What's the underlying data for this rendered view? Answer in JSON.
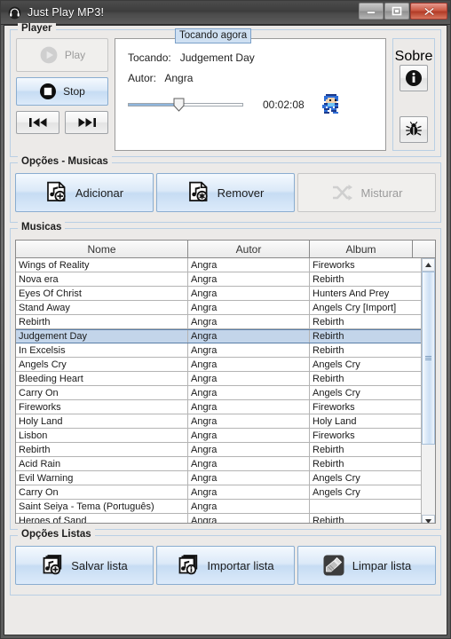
{
  "window": {
    "title": "Just Play MP3!",
    "icon": "headphones-icon",
    "controls": {
      "minimize": "minimize-icon",
      "maximize": "maximize-icon",
      "close": "close-icon"
    }
  },
  "player": {
    "legend": "Player",
    "play_label": "Play",
    "stop_label": "Stop",
    "prev_label": "previous-track-icon",
    "next_label": "next-track-icon",
    "now_playing_badge": "Tocando agora",
    "track_label": "Tocando:",
    "track_value": "Judgement Day",
    "artist_label": "Autor:",
    "artist_value": "Angra",
    "time": "00:02:08",
    "progress_percent": 44,
    "sprite": "megaman-sprite"
  },
  "sobre": {
    "legend": "Sobre",
    "info_button": "info-icon",
    "bug_button": "bug-icon"
  },
  "song_options": {
    "legend": "Opções - Musicas",
    "buttons": [
      {
        "label": "Adicionar",
        "icon": "add-music-icon",
        "enabled": true
      },
      {
        "label": "Remover",
        "icon": "remove-music-icon",
        "enabled": true
      },
      {
        "label": "Misturar",
        "icon": "shuffle-icon",
        "enabled": false
      }
    ]
  },
  "musicas": {
    "legend": "Musicas",
    "columns": [
      "Nome",
      "Autor",
      "Album"
    ],
    "selected_index": 5,
    "rows": [
      {
        "nome": "Wings of Reality",
        "autor": "Angra",
        "album": "Fireworks"
      },
      {
        "nome": "Nova era",
        "autor": "Angra",
        "album": "Rebirth"
      },
      {
        "nome": "Eyes Of Christ",
        "autor": "Angra",
        "album": "Hunters And Prey"
      },
      {
        "nome": "Stand Away",
        "autor": "Angra",
        "album": "Angels Cry [Import]"
      },
      {
        "nome": "Rebirth",
        "autor": "Angra",
        "album": "Rebirth"
      },
      {
        "nome": "Judgement Day",
        "autor": "Angra",
        "album": "Rebirth"
      },
      {
        "nome": "In Excelsis",
        "autor": "Angra",
        "album": "Rebirth"
      },
      {
        "nome": "Angels Cry",
        "autor": "Angra",
        "album": "Angels Cry"
      },
      {
        "nome": "Bleeding Heart",
        "autor": "Angra",
        "album": "Rebirth"
      },
      {
        "nome": "Carry On",
        "autor": "Angra",
        "album": "Angels Cry"
      },
      {
        "nome": "Fireworks",
        "autor": "Angra",
        "album": "Fireworks"
      },
      {
        "nome": "Holy Land",
        "autor": "Angra",
        "album": "Holy Land"
      },
      {
        "nome": "Lisbon",
        "autor": "Angra",
        "album": "Fireworks"
      },
      {
        "nome": "Rebirth",
        "autor": "Angra",
        "album": "Rebirth"
      },
      {
        "nome": "Acid Rain",
        "autor": "Angra",
        "album": "Rebirth"
      },
      {
        "nome": "Evil Warning",
        "autor": "Angra",
        "album": "Angels Cry"
      },
      {
        "nome": "Carry On",
        "autor": "Angra",
        "album": "Angels Cry"
      },
      {
        "nome": " Saint Seiya - Tema (Português)",
        "autor": "Angra",
        "album": ""
      },
      {
        "nome": "Heroes of Sand",
        "autor": "Angra",
        "album": "Rebirth"
      }
    ],
    "scrollbar": {
      "up": "scroll-up-icon",
      "down": "scroll-down-icon",
      "thumb_percent": 71
    }
  },
  "list_options": {
    "legend": "Opções Listas",
    "buttons": [
      {
        "label": "Salvar lista",
        "icon": "save-list-icon"
      },
      {
        "label": "Importar lista",
        "icon": "import-list-icon"
      },
      {
        "label": "Limpar lista",
        "icon": "clear-list-icon"
      }
    ]
  },
  "colors": {
    "accent": "#b9cfe4",
    "selection": "#c3d5ea",
    "badge_bg": "#cfe0f2",
    "close_button": "#b23b27",
    "client_bg": "#eceae8"
  }
}
